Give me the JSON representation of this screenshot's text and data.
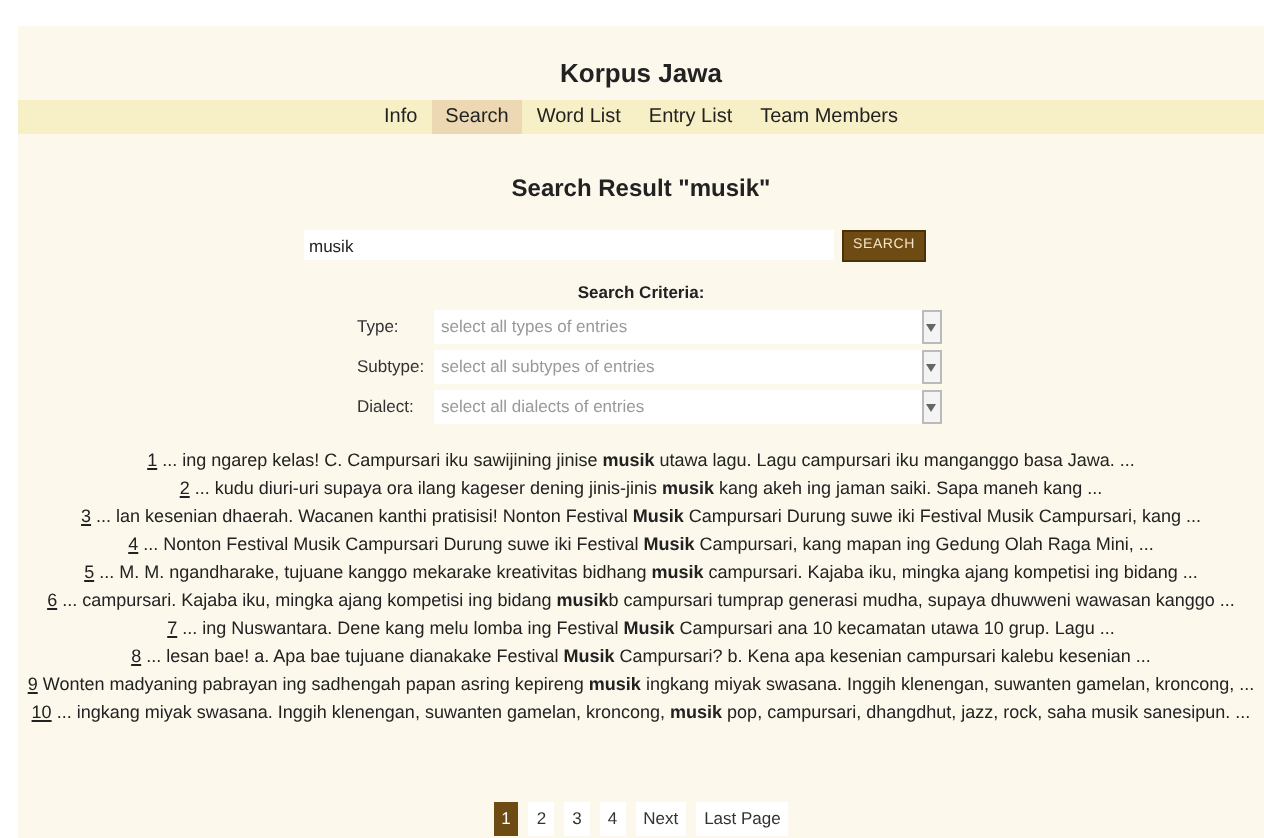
{
  "site_title": "Korpus Jawa",
  "nav": [
    {
      "label": "Info",
      "selected": false
    },
    {
      "label": "Search",
      "selected": true
    },
    {
      "label": "Word List",
      "selected": false
    },
    {
      "label": "Entry List",
      "selected": false
    },
    {
      "label": "Team Members",
      "selected": false
    }
  ],
  "heading": "Search Result \"musik\"",
  "search": {
    "value": "musik",
    "button": "SEARCH"
  },
  "criteria": {
    "title": "Search Criteria:",
    "fields": [
      {
        "label": "Type:",
        "placeholder": "select all types of entries"
      },
      {
        "label": "Subtype:",
        "placeholder": "select all subtypes of entries"
      },
      {
        "label": "Dialect:",
        "placeholder": "select all dialects of entries"
      }
    ]
  },
  "results": [
    {
      "number": "1",
      "text": "... ing ngarep kelas! C. Campursari iku sawijining jinise **musik** utawa lagu. Lagu campursari iku manganggo basa Jawa. ..."
    },
    {
      "number": "2",
      "text": "... kudu diuri-uri supaya ora ilang kageser dening jinis-jinis **musik** kang akeh ing jaman saiki. Sapa maneh kang ..."
    },
    {
      "number": "3",
      "text": "... lan kesenian dhaerah. Wacanen kanthi pratisisi! Nonton Festival **Musik** Campursari Durung suwe iki Festival Musik Campursari, kang ..."
    },
    {
      "number": "4",
      "text": "... Nonton Festival Musik Campursari Durung suwe iki Festival **Musik** Campursari, kang mapan ing Gedung Olah Raga Mini, ..."
    },
    {
      "number": "5",
      "text": "... M. M. ngandharake, tujuane kanggo mekarake kreativitas bidhang **musik** campursari. Kajaba iku, mingka ajang kompetisi ing bidang ..."
    },
    {
      "number": "6",
      "text": "... campursari. Kajaba iku, mingka ajang kompetisi ing bidang **musik**b campursari tumprap generasi mudha, supaya dhuwweni wawasan kanggo ..."
    },
    {
      "number": "7",
      "text": "... ing Nuswantara. Dene kang melu lomba ing Festival **Musik** Campursari ana 10 kecamatan utawa 10 grup. Lagu ..."
    },
    {
      "number": "8",
      "text": "... lesan bae! a. Apa bae tujuane dianakake Festival **Musik** Campursari? b. Kena apa kesenian campursari kalebu kesenian ..."
    },
    {
      "number": "9",
      "text": "Wonten madyaning pabrayan ing sadhengah papan asring kepireng **musik** ingkang miyak swasana. Inggih klenengan, suwanten gamelan, kroncong, ..."
    },
    {
      "number": "10",
      "text": "... ingkang miyak swasana. Inggih klenengan, suwanten gamelan, kroncong, **musik** pop, campursari, dhangdhut, jazz, rock, saha musik sanesipun. ..."
    }
  ],
  "pagination": [
    {
      "label": "1",
      "selected": true
    },
    {
      "label": "2",
      "selected": false
    },
    {
      "label": "3",
      "selected": false
    },
    {
      "label": "4",
      "selected": false
    },
    {
      "label": "Next",
      "selected": false
    },
    {
      "label": "Last Page",
      "selected": false
    }
  ]
}
